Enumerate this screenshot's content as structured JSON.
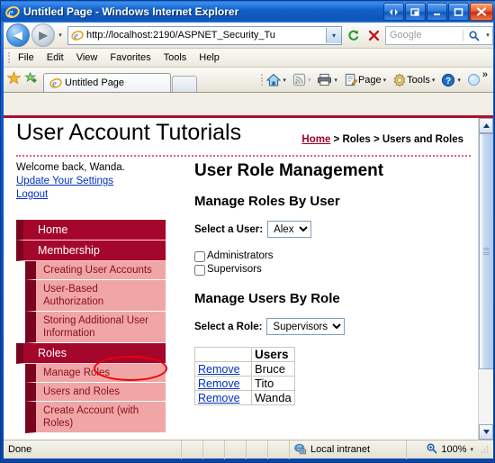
{
  "window": {
    "title": "Untitled Page - Windows Internet Explorer",
    "buttons": {
      "restore_group_label": "◀▶",
      "restore_down_label": "❐",
      "minimize_label": "–",
      "maximize_label": "□",
      "close_label": "✕"
    }
  },
  "navbar": {
    "back_label": "◀",
    "forward_label": "▶",
    "recent_pages_label": "▾",
    "url": "http://localhost:2190/ASPNET_Security_Tu",
    "url_dropdown_label": "▾",
    "refresh_label": "↻",
    "stop_label": "✕",
    "search_placeholder": "Google",
    "search_value": "",
    "search_go_label": "⚲",
    "search_dropdown_label": "▾"
  },
  "menubar": {
    "items": [
      "File",
      "Edit",
      "View",
      "Favorites",
      "Tools",
      "Help"
    ]
  },
  "commandbar": {
    "favorites_center_label": "★",
    "add_to_favorites_label": "✦",
    "tab": {
      "title": "Untitled Page"
    },
    "new_tab_label": "",
    "items": [
      {
        "label": "",
        "icon": "home-icon",
        "caret": "▾"
      },
      {
        "label": "",
        "icon": "feeds-icon",
        "caret": "▾"
      },
      {
        "label": "",
        "icon": "print-icon",
        "caret": "▾"
      },
      {
        "label": "Page",
        "icon": "page-icon",
        "caret": "▾"
      },
      {
        "label": "Tools",
        "icon": "tools-icon",
        "caret": "▾"
      },
      {
        "label": "",
        "icon": "help-icon",
        "caret": "▾"
      },
      {
        "label": "",
        "icon": "discuss-icon",
        "caret": ""
      }
    ],
    "overflow_label": "»"
  },
  "page": {
    "site_title": "User Account Tutorials",
    "breadcrumb": {
      "home": "Home",
      "rest": " > Roles > Users and Roles"
    },
    "welcome": {
      "greeting": "Welcome back, Wanda.",
      "update_link": "Update Your Settings",
      "logout_link": "Logout"
    },
    "nav": [
      {
        "label": "Home",
        "type": "top"
      },
      {
        "label": "Membership",
        "type": "top"
      },
      {
        "label": "Creating User Accounts",
        "type": "sub"
      },
      {
        "label": "User-Based Authorization",
        "type": "sub"
      },
      {
        "label": "Storing Additional User Information",
        "type": "sub"
      },
      {
        "label": "Roles",
        "type": "top"
      },
      {
        "label": "Manage Roles",
        "type": "sub"
      },
      {
        "label": "Users and Roles",
        "type": "sub"
      },
      {
        "label": "Create Account (with Roles)",
        "type": "sub"
      }
    ],
    "main": {
      "heading": "User Role Management",
      "section_user": {
        "heading": "Manage Roles By User",
        "select_label": "Select a User:",
        "selected_user": "Alex",
        "user_options": [
          "Alex"
        ],
        "roles": [
          {
            "label": "Administrators",
            "checked": false
          },
          {
            "label": "Supervisors",
            "checked": false
          }
        ]
      },
      "section_role": {
        "heading": "Manage Users By Role",
        "select_label": "Select a Role:",
        "selected_role": "Supervisors",
        "role_options": [
          "Supervisors"
        ],
        "table": {
          "columns": [
            "",
            "Users"
          ],
          "rows": [
            {
              "action": "Remove",
              "user": "Bruce"
            },
            {
              "action": "Remove",
              "user": "Tito"
            },
            {
              "action": "Remove",
              "user": "Wanda"
            }
          ]
        }
      }
    }
  },
  "statusbar": {
    "status": "Done",
    "zone": "Local intranet",
    "zoom": "100%",
    "zoom_dropdown_label": "▾"
  },
  "colors": {
    "accent_red": "#a5072c",
    "accent_dark_red": "#7a0520",
    "sub_pink": "#f0a6a6",
    "link_blue": "#0030c0",
    "annotation_red": "#ee0000"
  }
}
